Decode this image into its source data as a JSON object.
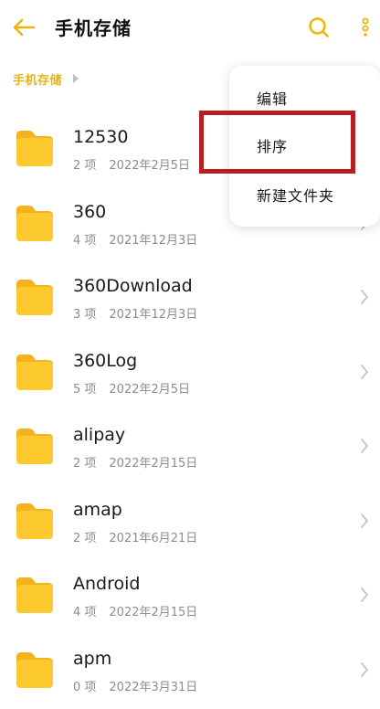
{
  "header": {
    "title": "手机存储",
    "back_icon": "arrow-left-icon",
    "search_icon": "search-icon",
    "more_icon": "more-vertical-icon"
  },
  "breadcrumb": {
    "items": [
      "手机存储"
    ]
  },
  "colors": {
    "accent": "#f0b400",
    "folder": "#fcc92f",
    "folder_tab": "#f4b21c",
    "highlight": "#b51f1f",
    "meta_text": "#8c8c8c"
  },
  "files": [
    {
      "name": "12530",
      "count": "2 项",
      "date": "2022年2月5日"
    },
    {
      "name": "360",
      "count": "4 项",
      "date": "2021年12月3日"
    },
    {
      "name": "360Download",
      "count": "3 项",
      "date": "2021年12月3日"
    },
    {
      "name": "360Log",
      "count": "5 项",
      "date": "2022年2月5日"
    },
    {
      "name": "alipay",
      "count": "2 项",
      "date": "2022年2月15日"
    },
    {
      "name": "amap",
      "count": "2 项",
      "date": "2021年6月21日"
    },
    {
      "name": "Android",
      "count": "4 项",
      "date": "2022年2月15日"
    },
    {
      "name": "apm",
      "count": "0 项",
      "date": "2022年3月31日"
    }
  ],
  "menu": {
    "items": [
      {
        "label": "编辑"
      },
      {
        "label": "排序"
      },
      {
        "label": "新建文件夹"
      }
    ]
  }
}
